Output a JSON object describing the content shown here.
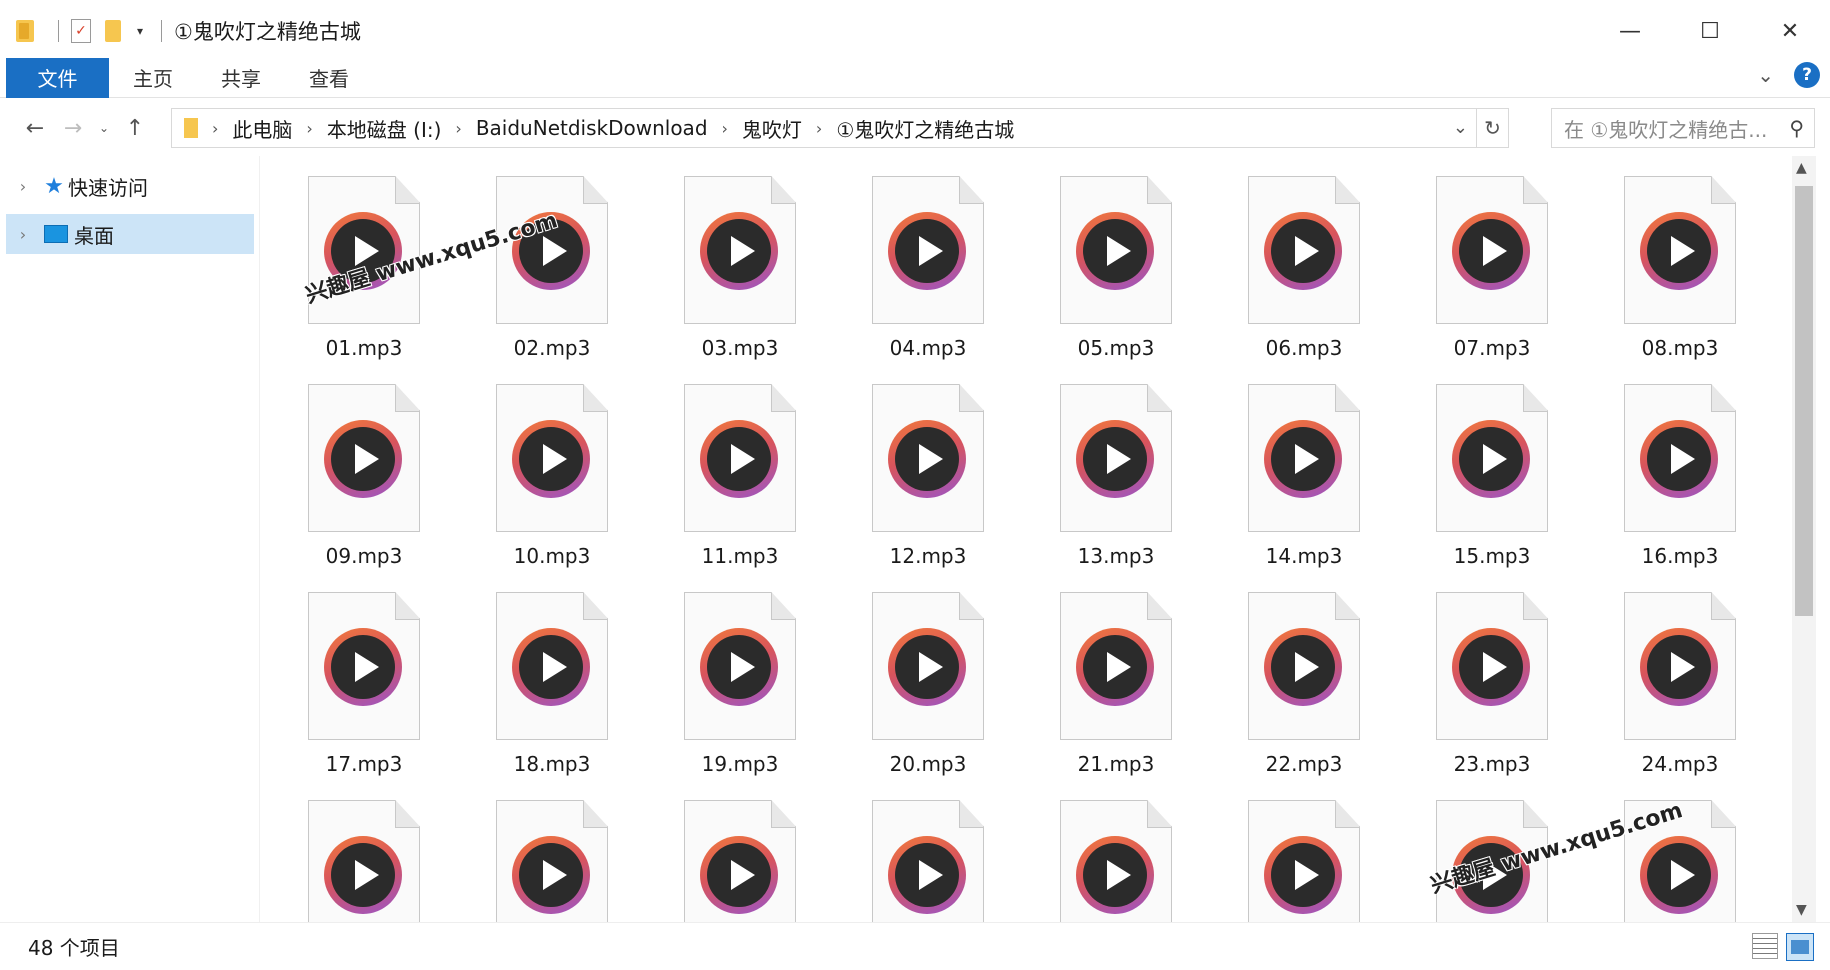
{
  "window": {
    "title": "①鬼吹灯之精绝古城",
    "minimize_glyph": "—",
    "maximize_glyph": "☐",
    "close_glyph": "✕"
  },
  "quick_access_toolbar": {
    "dropdown_glyph": "▾"
  },
  "ribbon": {
    "tabs": [
      {
        "label": "文件"
      },
      {
        "label": "主页"
      },
      {
        "label": "共享"
      },
      {
        "label": "查看"
      }
    ],
    "expand_glyph": "⌄",
    "help_glyph": "?"
  },
  "navigation": {
    "back_glyph": "←",
    "forward_glyph": "→",
    "recent_glyph": "⌄",
    "up_glyph": "↑",
    "breadcrumbs": [
      "此电脑",
      "本地磁盘 (I:)",
      "BaiduNetdiskDownload",
      "鬼吹灯",
      "①鬼吹灯之精绝古城"
    ],
    "refresh_glyph": "↻",
    "search_placeholder": "在 ①鬼吹灯之精绝古..."
  },
  "sidebar": {
    "items": [
      {
        "label": "快速访问",
        "icon": "star-icon",
        "selected": false
      },
      {
        "label": "桌面",
        "icon": "desktop-icon",
        "selected": true
      }
    ]
  },
  "files": [
    "01.mp3",
    "02.mp3",
    "03.mp3",
    "04.mp3",
    "05.mp3",
    "06.mp3",
    "07.mp3",
    "08.mp3",
    "09.mp3",
    "10.mp3",
    "11.mp3",
    "12.mp3",
    "13.mp3",
    "14.mp3",
    "15.mp3",
    "16.mp3",
    "17.mp3",
    "18.mp3",
    "19.mp3",
    "20.mp3",
    "21.mp3",
    "22.mp3",
    "23.mp3",
    "24.mp3",
    "",
    "",
    "",
    "",
    "",
    "",
    "",
    ""
  ],
  "status": {
    "item_count": "48 个项目"
  },
  "watermarks": [
    "兴趣屋 www.xqu5.com",
    "兴趣屋 www.xqu5.com"
  ],
  "colors": {
    "accent": "#1a6fc4",
    "selection": "#cce4f7",
    "folder": "#f6c64f"
  }
}
